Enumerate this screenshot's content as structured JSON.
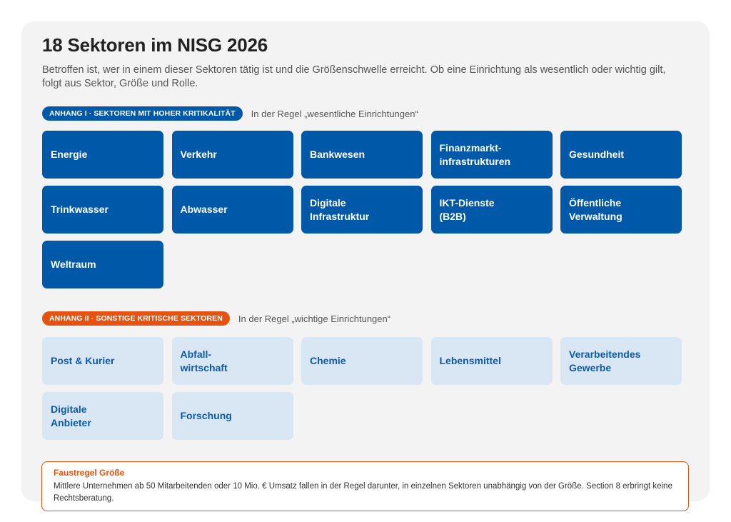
{
  "header": {
    "title": "18 Sektoren im NISG 2026",
    "subtitle": "Betroffen ist, wer in einem dieser Sektoren tätig ist und die Größenschwelle erreicht. Ob eine Einrichtung als wesentlich oder wichtig gilt, folgt aus Sektor, Größe und Rolle."
  },
  "annex1": {
    "badge": "ANHANG I · SEKTOREN MIT HOHER KRITIKALITÄT",
    "note": "In der Regel „wesentliche Einrichtungen“",
    "accent": "#0059a8",
    "sectors": [
      "Energie",
      "Verkehr",
      "Bankwesen",
      "Finanzmarkt-\ninfrastrukturen",
      "Gesundheit",
      "Trinkwasser",
      "Abwasser",
      "Digitale\nInfrastruktur",
      "IKT-Dienste\n(B2B)",
      "Öffentliche\nVerwaltung",
      "Weltraum"
    ]
  },
  "annex2": {
    "badge": "ANHANG II · SONSTIGE KRITISCHE SEKTOREN",
    "note": "In der Regel „wichtige Einrichtungen“",
    "accent": "#e45310",
    "sectors": [
      "Post & Kurier",
      "Abfall-\nwirtschaft",
      "Chemie",
      "Lebensmittel",
      "Verarbeitendes\nGewerbe",
      "Digitale\nAnbieter",
      "Forschung"
    ]
  },
  "rule_of_thumb": {
    "title": "Faustregel Größe",
    "text": "Mittlere Unternehmen ab 50 Mitarbeitenden oder 10 Mio. € Umsatz fallen in der Regel darunter, in einzelnen Sektoren unabhängig von der Größe. Section 8 erbringt keine Rechtsberatung."
  }
}
